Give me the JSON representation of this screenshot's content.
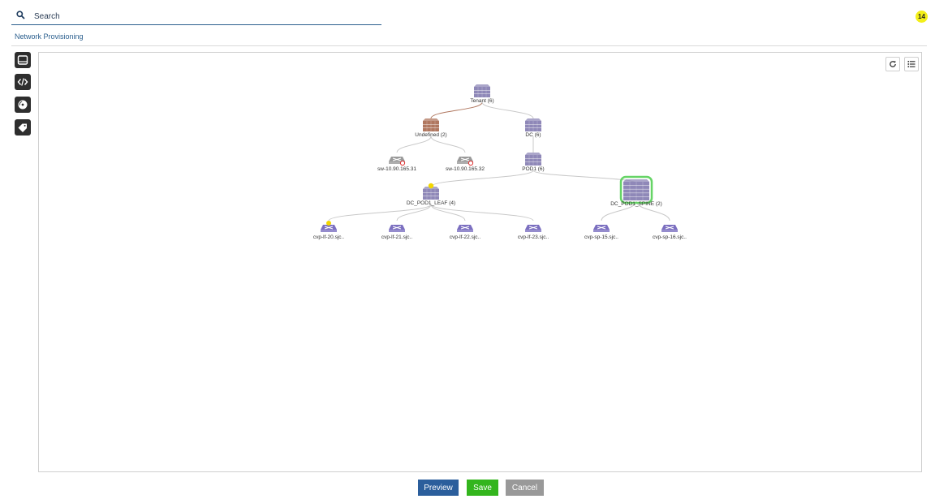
{
  "search": {
    "placeholder": "Search",
    "value": ""
  },
  "notification_count": "14",
  "breadcrumb": "Network Provisioning",
  "toolbar": {
    "tools": [
      {
        "name": "device-tool",
        "icon": "device-icon"
      },
      {
        "name": "code-tool",
        "icon": "code-icon"
      },
      {
        "name": "image-tool",
        "icon": "disc-icon"
      },
      {
        "name": "tag-tool",
        "icon": "tag-icon"
      }
    ]
  },
  "canvas_controls": {
    "refresh_icon": "refresh-icon",
    "list_icon": "list-icon"
  },
  "topology": {
    "nodes": [
      {
        "id": "tenant",
        "label": "Tenant (6)",
        "type": "container",
        "color": "#8f88b8"
      },
      {
        "id": "undefined",
        "label": "Undefined (2)",
        "type": "container",
        "color": "#b0775f"
      },
      {
        "id": "dc",
        "label": "DC (6)",
        "type": "container",
        "color": "#8f88b8"
      },
      {
        "id": "sw31",
        "label": "sw-10.90.165.31",
        "type": "switch-error",
        "color": "#9a9a9a"
      },
      {
        "id": "sw32",
        "label": "sw-10.90.165.32",
        "type": "switch-error",
        "color": "#9a9a9a"
      },
      {
        "id": "pod1",
        "label": "POD1 (6)",
        "type": "container",
        "color": "#8f88b8"
      },
      {
        "id": "leaf",
        "label": "DC_POD1_LEAF (4)",
        "type": "container-warning",
        "color": "#8f88b8"
      },
      {
        "id": "spine",
        "label": "DC_POD1_SPINE (2)",
        "type": "container-selected",
        "color": "#8f88b8"
      },
      {
        "id": "lf20",
        "label": "cvp-lf-20.sjc..",
        "type": "switch-warning",
        "color": "#7b6fc0"
      },
      {
        "id": "lf21",
        "label": "cvp-lf-21.sjc..",
        "type": "switch",
        "color": "#7b6fc0"
      },
      {
        "id": "lf22",
        "label": "cvp-lf-22.sjc..",
        "type": "switch",
        "color": "#7b6fc0"
      },
      {
        "id": "lf23",
        "label": "cvp-lf-23.sjc..",
        "type": "switch",
        "color": "#7b6fc0"
      },
      {
        "id": "sp15",
        "label": "cvp-sp-15.sjc..",
        "type": "switch",
        "color": "#7b6fc0"
      },
      {
        "id": "sp16",
        "label": "cvp-sp-16.sjc..",
        "type": "switch",
        "color": "#7b6fc0"
      }
    ],
    "edges": [
      {
        "from": "tenant",
        "to": "undefined",
        "color": "#b0775f"
      },
      {
        "from": "tenant",
        "to": "dc",
        "color": "#c8c8c8"
      },
      {
        "from": "undefined",
        "to": "sw31",
        "color": "#c8c8c8"
      },
      {
        "from": "undefined",
        "to": "sw32",
        "color": "#c8c8c8"
      },
      {
        "from": "dc",
        "to": "pod1",
        "color": "#c8c8c8"
      },
      {
        "from": "pod1",
        "to": "leaf",
        "color": "#c8c8c8"
      },
      {
        "from": "pod1",
        "to": "spine",
        "color": "#c8c8c8"
      },
      {
        "from": "leaf",
        "to": "lf20",
        "color": "#c8c8c8"
      },
      {
        "from": "leaf",
        "to": "lf21",
        "color": "#c8c8c8"
      },
      {
        "from": "leaf",
        "to": "lf22",
        "color": "#c8c8c8"
      },
      {
        "from": "leaf",
        "to": "lf23",
        "color": "#c8c8c8"
      },
      {
        "from": "spine",
        "to": "sp15",
        "color": "#c8c8c8"
      },
      {
        "from": "spine",
        "to": "sp16",
        "color": "#c8c8c8"
      }
    ]
  },
  "footer": {
    "preview_label": "Preview",
    "save_label": "Save",
    "cancel_label": "Cancel"
  }
}
